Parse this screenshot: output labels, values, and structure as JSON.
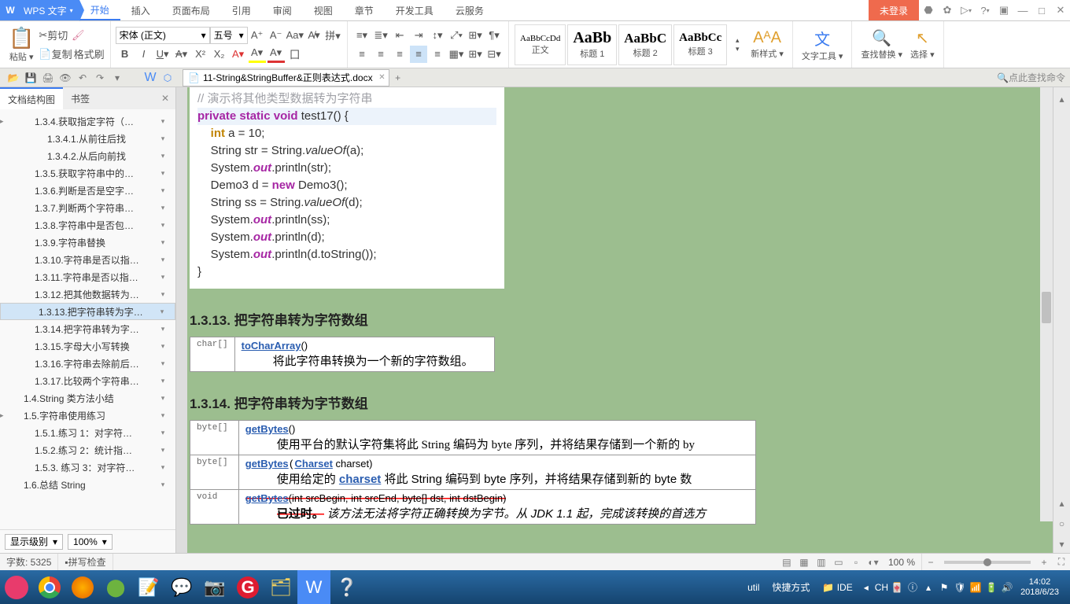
{
  "app": {
    "name": "WPS 文字"
  },
  "menu": {
    "tabs": [
      "开始",
      "插入",
      "页面布局",
      "引用",
      "审阅",
      "视图",
      "章节",
      "开发工具",
      "云服务"
    ],
    "active": 0
  },
  "title_right": {
    "login": "未登录"
  },
  "ribbon": {
    "paste": "粘贴",
    "cut": "剪切",
    "copy": "复制",
    "fmt": "格式刷",
    "font_name": "宋体 (正文)",
    "font_size": "五号",
    "styles": [
      {
        "preview": "AaBbCcDd",
        "label": "正文"
      },
      {
        "preview": "AaBb",
        "label": "标题 1"
      },
      {
        "preview": "AaBbC",
        "label": "标题 2"
      },
      {
        "preview": "AaBbCc",
        "label": "标题 3"
      }
    ],
    "new_style": "新样式",
    "text_tool": "文字工具",
    "find_replace": "查找替换",
    "select": "选择"
  },
  "tab_doc": {
    "name": "11-String&StringBuffer&正则表达式.docx"
  },
  "search_cmd": {
    "label": "点此查找命令"
  },
  "sidebar": {
    "tabs": {
      "outline": "文档结构图",
      "bookmark": "书签"
    },
    "items": [
      {
        "text": "1.3.4.获取指定字符（…",
        "caret": "▸",
        "indent": 44
      },
      {
        "text": "1.3.4.1.从前往后找",
        "indent": 60
      },
      {
        "text": "1.3.4.2.从后向前找",
        "indent": 60
      },
      {
        "text": "1.3.5.获取字符串中的…",
        "indent": 44
      },
      {
        "text": "1.3.6.判断是否是空字…",
        "indent": 44
      },
      {
        "text": "1.3.7.判断两个字符串…",
        "indent": 44
      },
      {
        "text": "1.3.8.字符串中是否包…",
        "indent": 44
      },
      {
        "text": "1.3.9.字符串替换",
        "indent": 44
      },
      {
        "text": "1.3.10.字符串是否以指…",
        "indent": 44
      },
      {
        "text": "1.3.11.字符串是否以指…",
        "indent": 44
      },
      {
        "text": "1.3.12.把其他数据转为…",
        "indent": 44
      },
      {
        "text": "1.3.13.把字符串转为字…",
        "indent": 44,
        "selected": true
      },
      {
        "text": "1.3.14.把字符串转为字…",
        "indent": 44
      },
      {
        "text": "1.3.15.字母大小写转换",
        "indent": 44
      },
      {
        "text": "1.3.16.字符串去除前后…",
        "indent": 44
      },
      {
        "text": "1.3.17.比较两个字符串…",
        "indent": 44
      },
      {
        "text": "1.4.String 类方法小结",
        "indent": 30
      },
      {
        "text": "1.5.字符串使用练习",
        "caret": "▸",
        "indent": 30
      },
      {
        "text": "1.5.1.练习 1：对字符…",
        "indent": 44
      },
      {
        "text": "1.5.2.练习 2：统计指…",
        "indent": 44
      },
      {
        "text": "1.5.3. 练习 3：对字符…",
        "indent": 44
      },
      {
        "text": "1.6.总结 String",
        "indent": 30
      }
    ],
    "level": "显示级别",
    "zoom": "100%"
  },
  "doc": {
    "comment": "// 演示将其他类型数据转为字符串",
    "h1313": "1.3.13. 把字符串转为字符数组",
    "t1": {
      "ret": "char[]",
      "fn": "toCharArray",
      "sig": "()",
      "desc": "将此字符串转换为一个新的字符数组。"
    },
    "h1314": "1.3.14. 把字符串转为字节数组",
    "t2a": {
      "ret": "byte[]",
      "fn": "getBytes",
      "sig": "()",
      "desc": "使用平台的默认字符集将此 String 编码为 byte 序列，并将结果存储到一个新的 by"
    },
    "t2b": {
      "ret": "byte[]",
      "fn": "getBytes",
      "link2": "Charset",
      "sig2": " charset)",
      "desc": "使用给定的 ",
      "link3": "charset",
      "desc2": " 将此 String 编码到 byte 序列，并将结果存储到新的 byte 数"
    },
    "t2c": {
      "ret": "void",
      "fn": "getBytes",
      "sig": "(int srcBegin, int srcEnd, byte[] dst, int dstBegin)",
      "dep": "已过时。",
      "desc": "该方法无法将字符正确转换为字节。从 JDK 1.1 起，完成该转换的首选方"
    }
  },
  "status": {
    "words": "字数: 5325",
    "spell": "拼写检查",
    "zoom": "100 %"
  },
  "taskbar": {
    "label1": "util",
    "label2": "快捷方式",
    "ide": "IDE",
    "ime": "CH",
    "time": "14:02",
    "date": "2018/6/23"
  }
}
